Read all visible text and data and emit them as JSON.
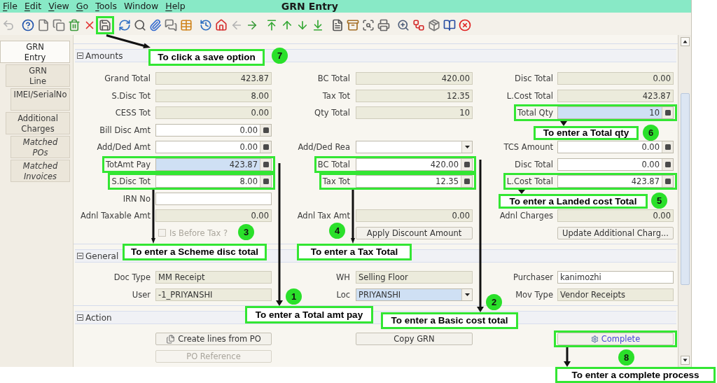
{
  "window": {
    "title": "GRN Entry"
  },
  "menu": [
    {
      "label": "File",
      "mnemonic": true
    },
    {
      "label": "Edit",
      "mnemonic": true
    },
    {
      "label": "View",
      "mnemonic": true
    },
    {
      "label": "Go",
      "mnemonic": true
    },
    {
      "label": "Tools",
      "mnemonic": true
    },
    {
      "label": "Window",
      "mnemonic": false
    },
    {
      "label": "Help",
      "mnemonic": true
    }
  ],
  "toolbar": [
    {
      "kind": "undo",
      "disabled": true,
      "highlighted": false
    },
    {
      "kind": "help",
      "disabled": false,
      "highlighted": false
    },
    {
      "kind": "new",
      "disabled": false,
      "highlighted": false
    },
    {
      "kind": "copy",
      "disabled": false,
      "highlighted": false
    },
    {
      "kind": "delete",
      "disabled": false,
      "highlighted": false
    },
    {
      "kind": "cancel",
      "disabled": false,
      "highlighted": false
    },
    {
      "kind": "save",
      "disabled": false,
      "highlighted": true
    },
    {
      "kind": "refresh",
      "disabled": false,
      "highlighted": false
    },
    {
      "kind": "find",
      "disabled": false,
      "highlighted": false
    },
    {
      "kind": "attach",
      "disabled": false,
      "highlighted": false
    },
    {
      "kind": "chat",
      "disabled": false,
      "highlighted": false
    },
    {
      "kind": "grid",
      "disabled": false,
      "highlighted": false
    },
    {
      "kind": "history",
      "disabled": false,
      "highlighted": false
    },
    {
      "kind": "home",
      "disabled": false,
      "highlighted": false
    },
    {
      "kind": "previous",
      "disabled": true,
      "highlighted": false
    },
    {
      "kind": "next",
      "disabled": false,
      "highlighted": false
    },
    {
      "kind": "first",
      "disabled": false,
      "highlighted": false
    },
    {
      "kind": "up",
      "disabled": false,
      "highlighted": false
    },
    {
      "kind": "down",
      "disabled": false,
      "highlighted": false
    },
    {
      "kind": "last",
      "disabled": false,
      "highlighted": false
    },
    {
      "kind": "report",
      "disabled": false,
      "highlighted": false
    },
    {
      "kind": "archive",
      "disabled": false,
      "highlighted": false
    },
    {
      "kind": "preview",
      "disabled": false,
      "highlighted": false
    },
    {
      "kind": "print",
      "disabled": false,
      "highlighted": false
    },
    {
      "kind": "zoom",
      "disabled": false,
      "highlighted": false
    },
    {
      "kind": "workflow",
      "disabled": false,
      "highlighted": false
    },
    {
      "kind": "product",
      "disabled": false,
      "highlighted": false
    },
    {
      "kind": "form",
      "disabled": false,
      "highlighted": false
    },
    {
      "kind": "close",
      "disabled": false,
      "highlighted": false
    }
  ],
  "tabs": [
    {
      "label": "GRN Entry",
      "selected": true,
      "italic": false,
      "children": [
        {
          "label": "GRN Line",
          "selected": false,
          "italic": false,
          "children": [
            {
              "label": "IMEI/SerialNo",
              "selected": false,
              "italic": false
            }
          ]
        },
        {
          "label": "Additional Charges",
          "selected": false,
          "italic": false,
          "children": [
            {
              "label": "Matched POs",
              "selected": false,
              "italic": true
            },
            {
              "label": "Matched Invoices",
              "selected": false,
              "italic": true
            }
          ]
        }
      ]
    }
  ],
  "sections": [
    {
      "title": "Amounts",
      "expanded": true,
      "rows": [
        {
          "left": {
            "label": "Grand Total",
            "value": "423.87",
            "kind": "number",
            "readonly": true,
            "mandatory": false,
            "highlighted": false
          },
          "center": {
            "label": "BC Total",
            "value": "420.00",
            "kind": "number",
            "readonly": true,
            "mandatory": false,
            "highlighted": false
          },
          "right": {
            "label": "Disc Total",
            "value": "0.00",
            "kind": "number",
            "readonly": true,
            "mandatory": false,
            "highlighted": false
          }
        },
        {
          "left": {
            "label": "S.Disc Tot",
            "value": "8.00",
            "kind": "number",
            "readonly": true,
            "mandatory": false,
            "highlighted": false
          },
          "center": {
            "label": "Tax Tot",
            "value": "12.35",
            "kind": "number",
            "readonly": true,
            "mandatory": false,
            "highlighted": false
          },
          "right": {
            "label": "L.Cost Total",
            "value": "423.87",
            "kind": "number",
            "readonly": true,
            "mandatory": false,
            "highlighted": false
          }
        },
        {
          "left": {
            "label": "CESS Tot",
            "value": "0.00",
            "kind": "number",
            "readonly": true,
            "mandatory": false,
            "highlighted": false
          },
          "center": {
            "label": "Qty Total",
            "value": "10",
            "kind": "number",
            "readonly": true,
            "mandatory": false,
            "highlighted": false
          },
          "right": {
            "label": "Total Qty",
            "value": "10",
            "kind": "number",
            "readonly": false,
            "mandatory": true,
            "highlighted": true
          }
        },
        {
          "left": {
            "label": "Bill Disc Amt",
            "value": "0.00",
            "kind": "number",
            "readonly": false,
            "mandatory": false,
            "highlighted": false
          }
        },
        {
          "left": {
            "label": "Add/Ded Amt",
            "value": "0.00",
            "kind": "number",
            "readonly": false,
            "mandatory": false,
            "highlighted": false
          },
          "center": {
            "label": "Add/Ded Rea",
            "kind": "select",
            "readonly": false,
            "mandatory": false,
            "highlighted": false
          },
          "right": {
            "label": "TCS Amount",
            "value": "0.00",
            "kind": "number",
            "readonly": false,
            "mandatory": false,
            "highlighted": false
          }
        },
        {
          "left": {
            "label": "TotAmt Pay",
            "value": "423.87",
            "kind": "number",
            "readonly": false,
            "mandatory": true,
            "highlighted": true
          },
          "center": {
            "label": "BC Total",
            "value": "420.00",
            "kind": "number",
            "readonly": false,
            "mandatory": false,
            "highlighted": true
          },
          "right": {
            "label": "Disc Total",
            "value": "0.00",
            "kind": "number",
            "readonly": false,
            "mandatory": false,
            "highlighted": false
          }
        },
        {
          "left": {
            "label": "S.Disc Tot",
            "value": "8.00",
            "kind": "number",
            "readonly": false,
            "mandatory": false,
            "highlighted": true
          },
          "center": {
            "label": "Tax Tot",
            "value": "12.35",
            "kind": "number",
            "readonly": false,
            "mandatory": false,
            "highlighted": true
          },
          "right": {
            "label": "L.Cost Total",
            "value": "423.87",
            "kind": "number",
            "readonly": false,
            "mandatory": false,
            "highlighted": true
          }
        },
        {
          "left": {
            "label": "IRN No",
            "kind": "text",
            "readonly": false,
            "mandatory": false,
            "highlighted": false
          }
        },
        {
          "left": {
            "label": "Adnl Taxable Amt",
            "value": "0.00",
            "kind": "number",
            "readonly": true,
            "mandatory": false,
            "highlighted": false
          },
          "center": {
            "label": "Adnl Tax Amt",
            "value": "0.00",
            "kind": "number",
            "readonly": true,
            "mandatory": false,
            "highlighted": false
          },
          "right": {
            "label": "Adnl Charges",
            "value": "0.00",
            "kind": "number",
            "readonly": true,
            "mandatory": false,
            "highlighted": false
          }
        },
        {
          "left": {
            "label": "Is Before Tax ?",
            "kind": "checkbox",
            "checked": false,
            "disabled": true,
            "highlighted": false
          },
          "center": {
            "label": "Apply Discount Amount",
            "kind": "button",
            "disabled": false,
            "highlighted": false
          },
          "right": {
            "label": "Update Additional Charg...",
            "kind": "button",
            "disabled": false,
            "highlighted": false
          }
        }
      ]
    },
    {
      "title": "General",
      "expanded": true,
      "rows": [
        {
          "left": {
            "label": "Doc Type",
            "value": "MM Receipt",
            "kind": "text",
            "readonly": true,
            "mandatory": false,
            "highlighted": false
          },
          "center": {
            "label": "WH",
            "value": "Selling Floor",
            "kind": "text",
            "readonly": true,
            "mandatory": false,
            "highlighted": false
          },
          "right": {
            "label": "Purchaser",
            "value": "kanimozhi",
            "kind": "text",
            "readonly": false,
            "mandatory": false,
            "highlighted": false
          }
        },
        {
          "left": {
            "label": "User",
            "value": "-1_PRIYANSHI",
            "kind": "text",
            "readonly": true,
            "mandatory": false,
            "highlighted": false
          },
          "center": {
            "label": "Loc",
            "value": "PRIYANSHI",
            "kind": "select",
            "readonly": false,
            "mandatory": true,
            "highlighted": false
          },
          "right": {
            "label": "Mov Type",
            "value": "Vendor Receipts",
            "kind": "text",
            "readonly": true,
            "mandatory": false,
            "highlighted": false
          }
        }
      ]
    },
    {
      "title": "Action",
      "expanded": true,
      "rows": [
        {
          "left": {
            "label": "Create lines from PO",
            "kind": "create",
            "disabled": false,
            "highlighted": false
          },
          "center": {
            "label": "Copy GRN",
            "kind": "button",
            "disabled": false,
            "highlighted": false
          },
          "right": {
            "label": "Complete",
            "kind": "process",
            "disabled": false,
            "highlighted": true
          }
        },
        {
          "left": {
            "label": "PO Reference",
            "kind": "button",
            "disabled": true,
            "highlighted": false
          }
        }
      ]
    }
  ],
  "annotations": [
    {
      "number": "7",
      "text": "To click a save option"
    },
    {
      "number": "6",
      "text": "To enter a Total qty"
    },
    {
      "number": "5",
      "text": "To enter a Landed cost Total"
    },
    {
      "number": "3",
      "text": "To enter a Scheme disc total"
    },
    {
      "number": "4",
      "text": "To enter a Tax Total"
    },
    {
      "number": "1",
      "text": "To enter a Total amt pay"
    },
    {
      "number": "2",
      "text": "To enter a Basic cost total"
    },
    {
      "number": "8",
      "text": "To enter a complete process"
    }
  ]
}
